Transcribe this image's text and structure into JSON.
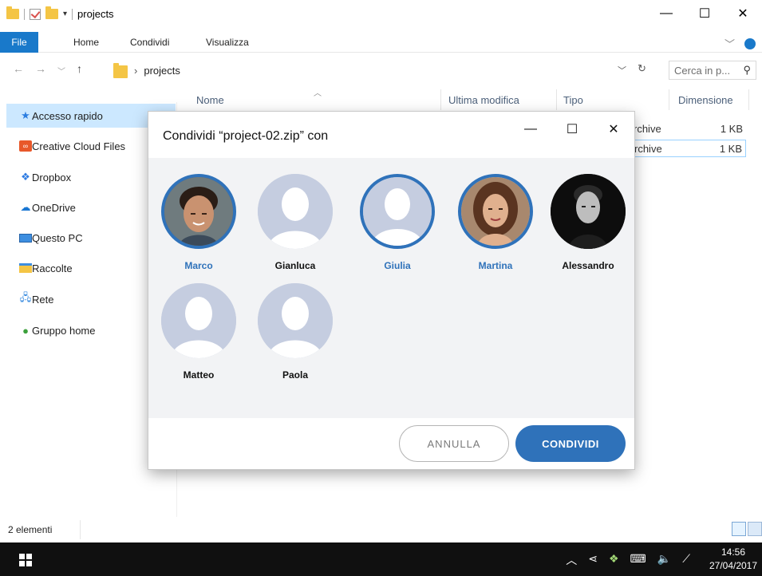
{
  "window": {
    "title": "projects",
    "controls": [
      "—",
      "☐",
      "✕"
    ]
  },
  "ribbon": {
    "tabs": [
      "File",
      "Home",
      "Condividi",
      "Visualizza"
    ]
  },
  "address": {
    "path": "projects",
    "search_placeholder": "Cerca in p..."
  },
  "sidebar": {
    "items": [
      {
        "label": "Accesso rapido",
        "icon": "star-icon"
      },
      {
        "label": "Creative Cloud Files",
        "icon": "creative-cloud-icon"
      },
      {
        "label": "Dropbox",
        "icon": "dropbox-icon"
      },
      {
        "label": "OneDrive",
        "icon": "onedrive-icon"
      },
      {
        "label": "Questo PC",
        "icon": "computer-icon"
      },
      {
        "label": "Raccolte",
        "icon": "libraries-icon"
      },
      {
        "label": "Rete",
        "icon": "network-icon"
      },
      {
        "label": "Gruppo home",
        "icon": "homegroup-icon"
      }
    ]
  },
  "columns": {
    "name": "Nome",
    "modified": "Ultima modifica",
    "type": "Tipo",
    "size": "Dimensione"
  },
  "files": [
    {
      "type": "rchive",
      "size": "1 KB"
    },
    {
      "type": "rchive",
      "size": "1 KB"
    }
  ],
  "status": {
    "count": "2 elementi"
  },
  "dialog": {
    "title": "Condividi “project-02.zip” con",
    "contacts": [
      {
        "name": "Marco",
        "selected": true,
        "photo": "photo"
      },
      {
        "name": "Gianluca",
        "selected": false,
        "photo": "placeholder"
      },
      {
        "name": "Giulia",
        "selected": true,
        "photo": "placeholder"
      },
      {
        "name": "Martina",
        "selected": true,
        "photo": "photo"
      },
      {
        "name": "Alessandro",
        "selected": false,
        "photo": "photo-dark"
      },
      {
        "name": "Matteo",
        "selected": false,
        "photo": "placeholder"
      },
      {
        "name": "Paola",
        "selected": false,
        "photo": "placeholder"
      }
    ],
    "cancel_label": "ANNULLA",
    "share_label": "CONDIVIDI"
  },
  "taskbar": {
    "time": "14:56",
    "date": "27/04/2017"
  },
  "colors": {
    "accent": "#2f72ba",
    "ribbon_file": "#1979ca",
    "selection": "#cce8ff"
  }
}
